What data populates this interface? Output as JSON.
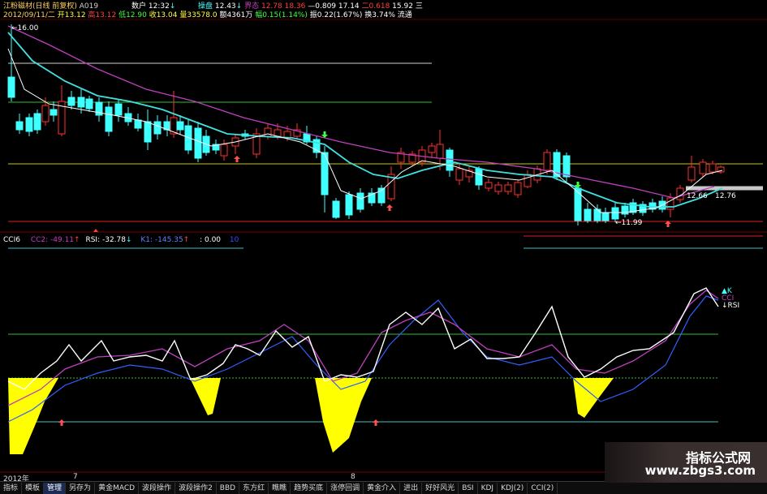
{
  "header": {
    "stock": "江粉磁材(日线 前复权)",
    "code": "A019",
    "seq": "数户",
    "time": "12:32",
    "r1": "操盘",
    "r1v": "12.43",
    "r2": "界态",
    "r2v": "12.78",
    "r3v": "18.36",
    "r4": "—0.809",
    "r4v": "17.14",
    "r5": "二0.618",
    "r5v": "15.92",
    "r6": "三",
    "date": "2012/09/11/二",
    "open": "开13.12",
    "high": "高13.12",
    "low": "低12.90",
    "close": "收13.04",
    "vol": "量33578.0",
    "amt": "额4361万",
    "change": "幅0.15(1.14%)",
    "amp": "振0.22(1.67%)",
    "turn": "换3.74%",
    "flow": "流通"
  },
  "price_labels": {
    "high": "16.00",
    "low": "11.99",
    "r1": "12.66",
    "r2": "12.76"
  },
  "indicator": {
    "name": "CCI6",
    "cc2": "CC2: -49.11",
    "rsi": "RSI: -32.78",
    "k1": "K1: -145.35",
    "val": ": 0.00",
    "tail": "10",
    "legend_k": "▲K",
    "legend_cci": "CCI",
    "legend_rsi": "↓RSI"
  },
  "timeline": {
    "year": "2012年",
    "m7": "7",
    "m8": "8"
  },
  "tabs": [
    "指标",
    "模板",
    "管理",
    "另存为",
    "黄金MACD",
    "波段操作",
    "波段操作2",
    "BBD",
    "东方红",
    "瞧瞧",
    "趋势买底",
    "涨停回调",
    "黄金介入",
    "进出",
    "好好风光",
    "BSI",
    "KDJ",
    "KDJ(2)",
    "CCI(2)"
  ],
  "watermark": {
    "line1": "指标公式网",
    "line2": "www.zbgs3.com"
  },
  "colors": {
    "bull": "#ff3030",
    "bear": "#40ffff",
    "ma_fast": "#40e0e0",
    "ma_slow": "#c040c0",
    "ma_short": "#ffffff",
    "fill": "#ffff00"
  }
}
